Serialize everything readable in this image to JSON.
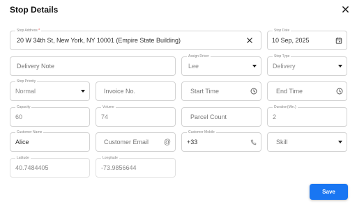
{
  "dialog": {
    "title": "Stop Details",
    "close_icon": "close-icon"
  },
  "fields": {
    "stop_address": {
      "label": "Stop Address",
      "required_mark": "*",
      "value": "20 W 34th St, New York, NY 10001 (Empire State Building)"
    },
    "stop_date": {
      "label": "Stop Date",
      "value": "10 Sep, 2025"
    },
    "delivery_note": {
      "placeholder": "Delivery Note"
    },
    "assign_driver": {
      "label": "Assign Driver",
      "value": "Lee"
    },
    "stop_type": {
      "label": "Stop Type",
      "value": "Delivery"
    },
    "stop_priority": {
      "label": "Stop Priority",
      "value": "Normal"
    },
    "invoice_no": {
      "placeholder": "Invoice No."
    },
    "start_time": {
      "placeholder": "Start Time"
    },
    "end_time": {
      "placeholder": "End Time"
    },
    "capacity": {
      "label": "Capacity",
      "value": "60"
    },
    "volume": {
      "label": "Volume",
      "value": "74"
    },
    "parcel_count": {
      "placeholder": "Parcel Count"
    },
    "duration": {
      "label": "Duration(Min.)",
      "value": "2"
    },
    "customer_name": {
      "label": "Customer Name",
      "value": "Alice"
    },
    "customer_email": {
      "placeholder": "Customer Email"
    },
    "customer_mobile": {
      "label": "Customer Mobile",
      "value": "+33"
    },
    "skill": {
      "placeholder": "Skill"
    },
    "latitude": {
      "label": "Latitude",
      "value": "40.7484405"
    },
    "longitude": {
      "label": "Longitude",
      "value": "-73.9856644"
    }
  },
  "save_label": "Save",
  "colors": {
    "primary": "#1976f2",
    "border": "#d3d3d3",
    "label": "#8a8a8a"
  }
}
